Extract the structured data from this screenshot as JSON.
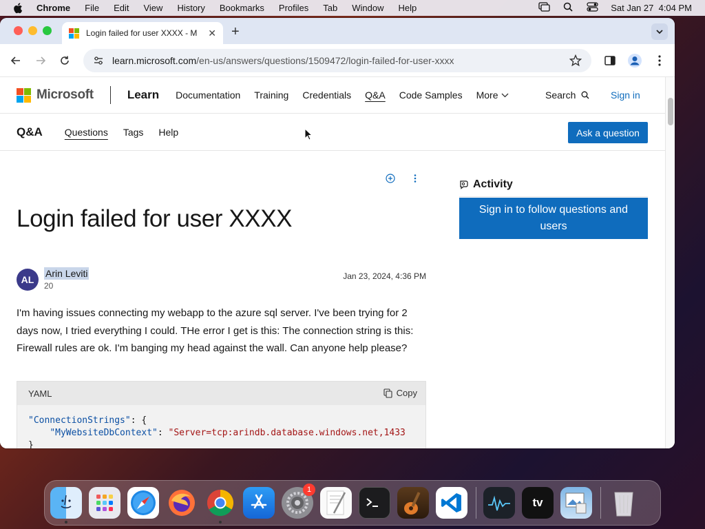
{
  "menubar": {
    "app_name": "Chrome",
    "items": [
      "File",
      "Edit",
      "View",
      "History",
      "Bookmarks",
      "Profiles",
      "Tab",
      "Window",
      "Help"
    ],
    "clock": "Sat Jan 27  4:04 PM"
  },
  "browser": {
    "tab_title": "Login failed for user XXXX - M",
    "url_host": "learn.microsoft.com",
    "url_path": "/en-us/answers/questions/1509472/login-failed-for-user-xxxx"
  },
  "site_header": {
    "brand": "Microsoft",
    "product": "Learn",
    "nav": [
      "Documentation",
      "Training",
      "Credentials",
      "Q&A",
      "Code Samples"
    ],
    "more": "More",
    "search": "Search",
    "signin": "Sign in"
  },
  "qa_bar": {
    "title": "Q&A",
    "links": [
      "Questions",
      "Tags",
      "Help"
    ],
    "ask_button": "Ask a question"
  },
  "question": {
    "title": "Login failed for user XXXX",
    "author_initials": "AL",
    "author_name": "Arin Leviti",
    "author_rep": "20",
    "date": "Jan 23, 2024, 4:36 PM",
    "body": "I'm having issues connecting my webapp to the azure sql server. I've been trying for 2 days now, I tried everything I could. THe error I get is this: The connection string is this: Firewall rules are ok. I'm banging my head against the wall. Can anyone help please?"
  },
  "code": {
    "language": "YAML",
    "copy_label": "Copy",
    "line1_key": "\"ConnectionStrings\"",
    "line1_punc": ": {",
    "line2_key": "\"MyWebsiteDbContext\"",
    "line2_punc": ": ",
    "line2_value": "\"Server=tcp:arindb.database.windows.net,1433",
    "line3_punc": "}"
  },
  "sidebar": {
    "activity_label": "Activity",
    "follow_button": "Sign in to follow questions and users"
  },
  "dock": {
    "apps": [
      "Finder",
      "Launchpad",
      "Safari",
      "Firefox",
      "Chrome",
      "App Store",
      "System Settings",
      "TextEdit",
      "Terminal",
      "GarageBand",
      "Visual Studio Code",
      "Activity Monitor",
      "Apple TV",
      "Preview",
      "Trash"
    ],
    "system_settings_badge": "1"
  },
  "colors": {
    "accent": "#0f6cbd",
    "ms_red": "#f25022",
    "ms_green": "#7fba00",
    "ms_blue": "#00a4ef",
    "ms_yellow": "#ffb900"
  }
}
